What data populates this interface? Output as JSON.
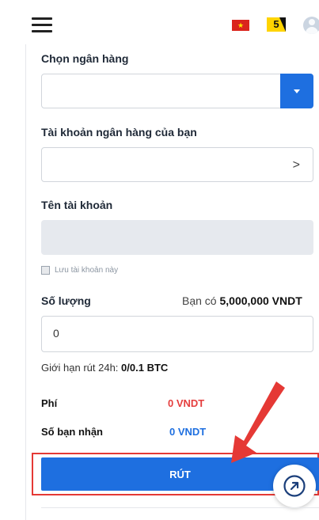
{
  "header": {
    "flag": "★",
    "badge": "5"
  },
  "form": {
    "bank_label": "Chọn ngân hàng",
    "bank_account_label": "Tài khoản ngân hàng của bạn",
    "bank_account_chevron": ">",
    "account_name_label": "Tên tài khoản",
    "save_account_label": "Lưu tài khoản này",
    "amount_label": "Số lượng",
    "balance_prefix": "Bạn có",
    "balance_value": "5,000,000 VNDT",
    "amount_value": "0",
    "limit_prefix": "Giới hạn rút 24h:",
    "limit_value": "0/0.1 BTC",
    "fee_label": "Phí",
    "fee_value": "0 VNDT",
    "receive_label": "Số bạn nhận",
    "receive_value": "0 VNDT",
    "submit_label": "RÚT"
  },
  "colors": {
    "accent": "#1e6fe0",
    "fee": "#e53e3e",
    "annotation": "#e53935"
  }
}
